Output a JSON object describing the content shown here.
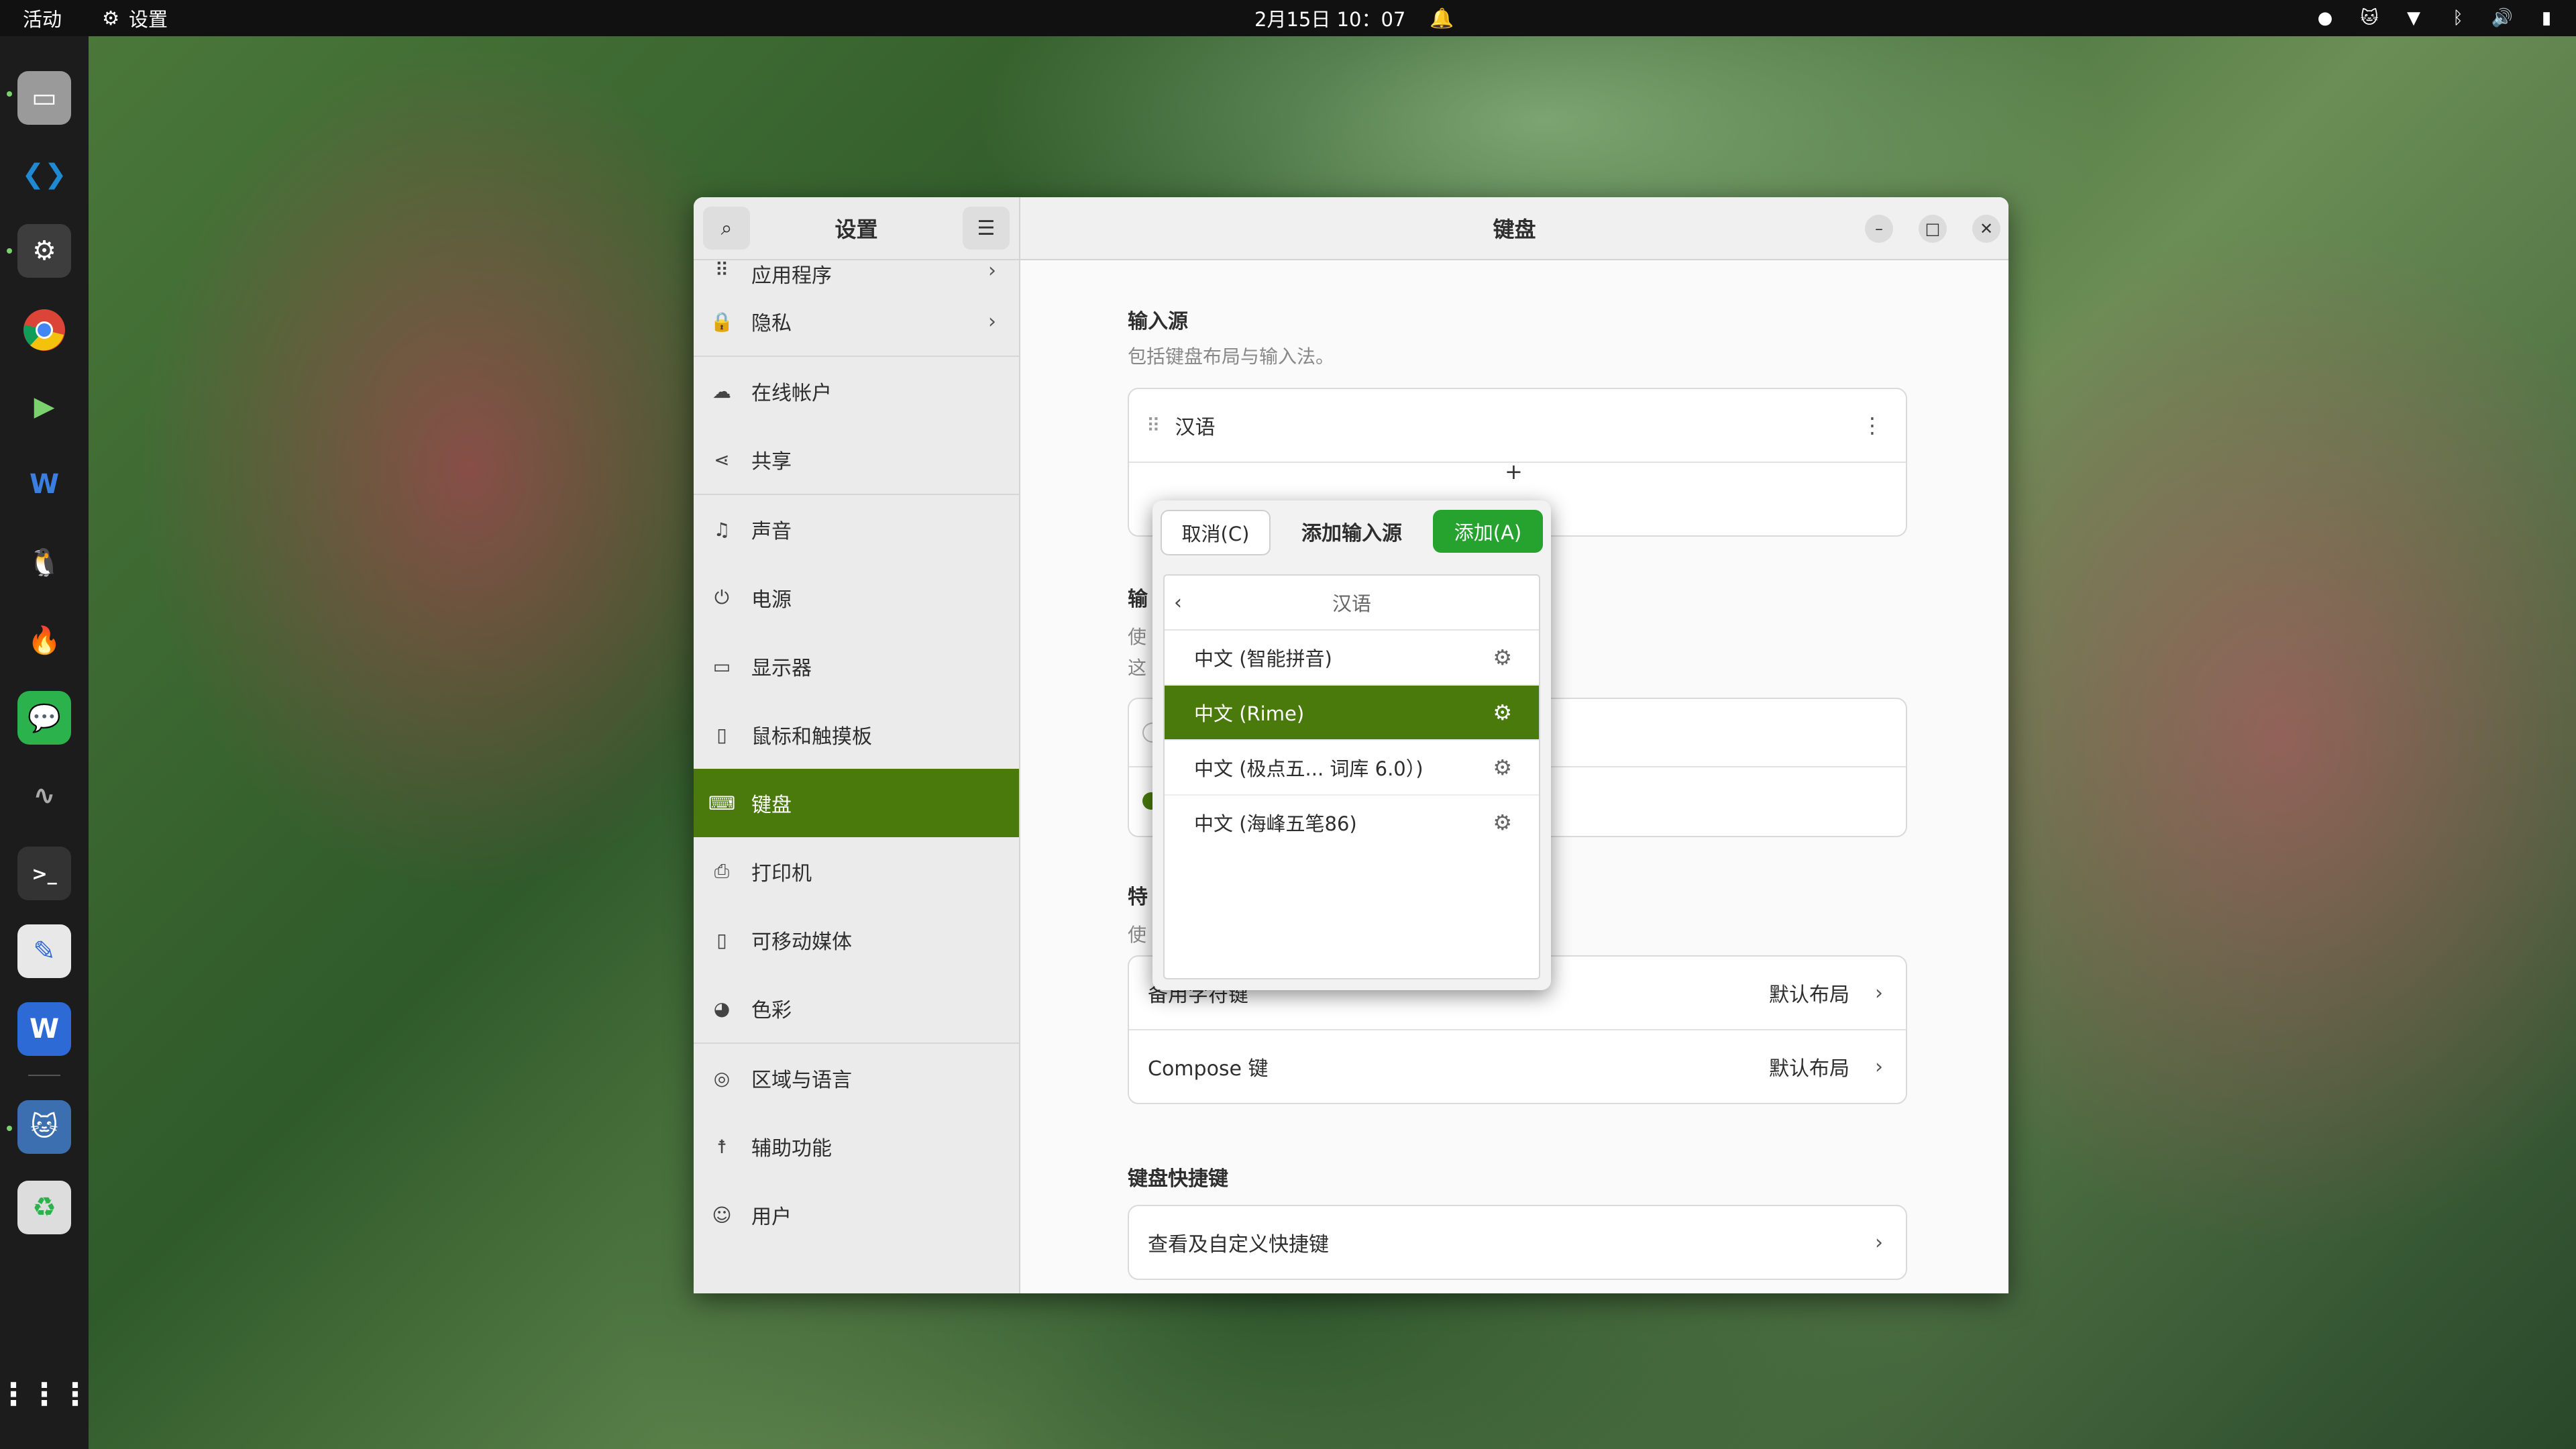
{
  "topbar": {
    "activities": "活动",
    "app_name": "设置",
    "clock": "2月15日  10：07"
  },
  "settings": {
    "sidebar_title": "设置",
    "window_title": "键盘",
    "nav_items": [
      {
        "label": "应用程序",
        "icon": "apps-icon"
      },
      {
        "label": "隐私",
        "icon": "lock-icon"
      },
      {
        "label": "在线帐户",
        "icon": "cloud-icon"
      },
      {
        "label": "共享",
        "icon": "share-icon"
      },
      {
        "label": "声音",
        "icon": "music-note-icon"
      },
      {
        "label": "电源",
        "icon": "power-icon"
      },
      {
        "label": "显示器",
        "icon": "display-icon"
      },
      {
        "label": "鼠标和触摸板",
        "icon": "mouse-icon"
      },
      {
        "label": "键盘",
        "icon": "keyboard-icon"
      },
      {
        "label": "打印机",
        "icon": "printer-icon"
      },
      {
        "label": "可移动媒体",
        "icon": "usb-icon"
      },
      {
        "label": "色彩",
        "icon": "palette-icon"
      },
      {
        "label": "区域与语言",
        "icon": "globe-icon"
      },
      {
        "label": "辅助功能",
        "icon": "accessibility-icon"
      },
      {
        "label": "用户",
        "icon": "user-icon"
      }
    ],
    "input_sources": {
      "title": "输入源",
      "subtitle": "包括键盘布局与输入法。",
      "items": [
        "汉语"
      ]
    },
    "partial": {
      "switch_title": "输",
      "switch_sub1": "使",
      "switch_sub2": "这",
      "special_title": "特",
      "special_sub": "使"
    },
    "special_keys": [
      {
        "label": "备用字符键",
        "value": "默认布局"
      },
      {
        "label": "Compose 键",
        "value": "默认布局"
      }
    ],
    "shortcuts": {
      "title": "键盘快捷键",
      "row": "查看及自定义快捷键"
    }
  },
  "dialog": {
    "cancel": "取消(C)",
    "title": "添加输入源",
    "add": "添加(A)",
    "group": "汉语",
    "options": [
      {
        "label": "中文 (智能拼音)",
        "selected": false
      },
      {
        "label": "中文 (Rime)",
        "selected": true
      },
      {
        "label": "中文 (极点五...   词库 6.0）)",
        "selected": false
      },
      {
        "label": "中文 (海峰五笔86)",
        "selected": false
      }
    ]
  },
  "colors": {
    "accent": "#4a7a0c",
    "add_button": "#26a22e"
  }
}
